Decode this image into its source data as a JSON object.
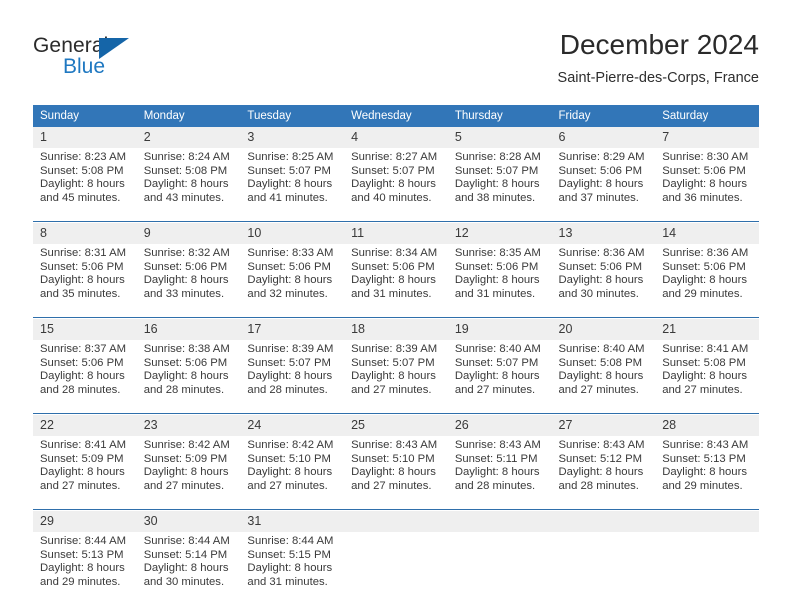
{
  "logo": {
    "text_primary": "General",
    "text_secondary": "Blue",
    "triangle_icon": "triangle-icon",
    "primary_color": "#2b2b2b",
    "secondary_color": "#1f78c1",
    "triangle_color": "#1565a8"
  },
  "header": {
    "title": "December 2024",
    "subtitle": "Saint-Pierre-des-Corps, France"
  },
  "colors": {
    "header_row_bg": "#3276b8",
    "header_row_text": "#ffffff",
    "daynum_bg": "#efefef",
    "separator": "#2f6fab",
    "body_text": "#3a3a3a"
  },
  "calendar": {
    "weekday_headers": [
      "Sunday",
      "Monday",
      "Tuesday",
      "Wednesday",
      "Thursday",
      "Friday",
      "Saturday"
    ],
    "weeks": [
      {
        "days": [
          {
            "date": "1",
            "sunrise": "Sunrise: 8:23 AM",
            "sunset": "Sunset: 5:08 PM",
            "daylight_line1": "Daylight: 8 hours",
            "daylight_line2": "and 45 minutes."
          },
          {
            "date": "2",
            "sunrise": "Sunrise: 8:24 AM",
            "sunset": "Sunset: 5:08 PM",
            "daylight_line1": "Daylight: 8 hours",
            "daylight_line2": "and 43 minutes."
          },
          {
            "date": "3",
            "sunrise": "Sunrise: 8:25 AM",
            "sunset": "Sunset: 5:07 PM",
            "daylight_line1": "Daylight: 8 hours",
            "daylight_line2": "and 41 minutes."
          },
          {
            "date": "4",
            "sunrise": "Sunrise: 8:27 AM",
            "sunset": "Sunset: 5:07 PM",
            "daylight_line1": "Daylight: 8 hours",
            "daylight_line2": "and 40 minutes."
          },
          {
            "date": "5",
            "sunrise": "Sunrise: 8:28 AM",
            "sunset": "Sunset: 5:07 PM",
            "daylight_line1": "Daylight: 8 hours",
            "daylight_line2": "and 38 minutes."
          },
          {
            "date": "6",
            "sunrise": "Sunrise: 8:29 AM",
            "sunset": "Sunset: 5:06 PM",
            "daylight_line1": "Daylight: 8 hours",
            "daylight_line2": "and 37 minutes."
          },
          {
            "date": "7",
            "sunrise": "Sunrise: 8:30 AM",
            "sunset": "Sunset: 5:06 PM",
            "daylight_line1": "Daylight: 8 hours",
            "daylight_line2": "and 36 minutes."
          }
        ]
      },
      {
        "days": [
          {
            "date": "8",
            "sunrise": "Sunrise: 8:31 AM",
            "sunset": "Sunset: 5:06 PM",
            "daylight_line1": "Daylight: 8 hours",
            "daylight_line2": "and 35 minutes."
          },
          {
            "date": "9",
            "sunrise": "Sunrise: 8:32 AM",
            "sunset": "Sunset: 5:06 PM",
            "daylight_line1": "Daylight: 8 hours",
            "daylight_line2": "and 33 minutes."
          },
          {
            "date": "10",
            "sunrise": "Sunrise: 8:33 AM",
            "sunset": "Sunset: 5:06 PM",
            "daylight_line1": "Daylight: 8 hours",
            "daylight_line2": "and 32 minutes."
          },
          {
            "date": "11",
            "sunrise": "Sunrise: 8:34 AM",
            "sunset": "Sunset: 5:06 PM",
            "daylight_line1": "Daylight: 8 hours",
            "daylight_line2": "and 31 minutes."
          },
          {
            "date": "12",
            "sunrise": "Sunrise: 8:35 AM",
            "sunset": "Sunset: 5:06 PM",
            "daylight_line1": "Daylight: 8 hours",
            "daylight_line2": "and 31 minutes."
          },
          {
            "date": "13",
            "sunrise": "Sunrise: 8:36 AM",
            "sunset": "Sunset: 5:06 PM",
            "daylight_line1": "Daylight: 8 hours",
            "daylight_line2": "and 30 minutes."
          },
          {
            "date": "14",
            "sunrise": "Sunrise: 8:36 AM",
            "sunset": "Sunset: 5:06 PM",
            "daylight_line1": "Daylight: 8 hours",
            "daylight_line2": "and 29 minutes."
          }
        ]
      },
      {
        "days": [
          {
            "date": "15",
            "sunrise": "Sunrise: 8:37 AM",
            "sunset": "Sunset: 5:06 PM",
            "daylight_line1": "Daylight: 8 hours",
            "daylight_line2": "and 28 minutes."
          },
          {
            "date": "16",
            "sunrise": "Sunrise: 8:38 AM",
            "sunset": "Sunset: 5:06 PM",
            "daylight_line1": "Daylight: 8 hours",
            "daylight_line2": "and 28 minutes."
          },
          {
            "date": "17",
            "sunrise": "Sunrise: 8:39 AM",
            "sunset": "Sunset: 5:07 PM",
            "daylight_line1": "Daylight: 8 hours",
            "daylight_line2": "and 28 minutes."
          },
          {
            "date": "18",
            "sunrise": "Sunrise: 8:39 AM",
            "sunset": "Sunset: 5:07 PM",
            "daylight_line1": "Daylight: 8 hours",
            "daylight_line2": "and 27 minutes."
          },
          {
            "date": "19",
            "sunrise": "Sunrise: 8:40 AM",
            "sunset": "Sunset: 5:07 PM",
            "daylight_line1": "Daylight: 8 hours",
            "daylight_line2": "and 27 minutes."
          },
          {
            "date": "20",
            "sunrise": "Sunrise: 8:40 AM",
            "sunset": "Sunset: 5:08 PM",
            "daylight_line1": "Daylight: 8 hours",
            "daylight_line2": "and 27 minutes."
          },
          {
            "date": "21",
            "sunrise": "Sunrise: 8:41 AM",
            "sunset": "Sunset: 5:08 PM",
            "daylight_line1": "Daylight: 8 hours",
            "daylight_line2": "and 27 minutes."
          }
        ]
      },
      {
        "days": [
          {
            "date": "22",
            "sunrise": "Sunrise: 8:41 AM",
            "sunset": "Sunset: 5:09 PM",
            "daylight_line1": "Daylight: 8 hours",
            "daylight_line2": "and 27 minutes."
          },
          {
            "date": "23",
            "sunrise": "Sunrise: 8:42 AM",
            "sunset": "Sunset: 5:09 PM",
            "daylight_line1": "Daylight: 8 hours",
            "daylight_line2": "and 27 minutes."
          },
          {
            "date": "24",
            "sunrise": "Sunrise: 8:42 AM",
            "sunset": "Sunset: 5:10 PM",
            "daylight_line1": "Daylight: 8 hours",
            "daylight_line2": "and 27 minutes."
          },
          {
            "date": "25",
            "sunrise": "Sunrise: 8:43 AM",
            "sunset": "Sunset: 5:10 PM",
            "daylight_line1": "Daylight: 8 hours",
            "daylight_line2": "and 27 minutes."
          },
          {
            "date": "26",
            "sunrise": "Sunrise: 8:43 AM",
            "sunset": "Sunset: 5:11 PM",
            "daylight_line1": "Daylight: 8 hours",
            "daylight_line2": "and 28 minutes."
          },
          {
            "date": "27",
            "sunrise": "Sunrise: 8:43 AM",
            "sunset": "Sunset: 5:12 PM",
            "daylight_line1": "Daylight: 8 hours",
            "daylight_line2": "and 28 minutes."
          },
          {
            "date": "28",
            "sunrise": "Sunrise: 8:43 AM",
            "sunset": "Sunset: 5:13 PM",
            "daylight_line1": "Daylight: 8 hours",
            "daylight_line2": "and 29 minutes."
          }
        ]
      },
      {
        "days": [
          {
            "date": "29",
            "sunrise": "Sunrise: 8:44 AM",
            "sunset": "Sunset: 5:13 PM",
            "daylight_line1": "Daylight: 8 hours",
            "daylight_line2": "and 29 minutes."
          },
          {
            "date": "30",
            "sunrise": "Sunrise: 8:44 AM",
            "sunset": "Sunset: 5:14 PM",
            "daylight_line1": "Daylight: 8 hours",
            "daylight_line2": "and 30 minutes."
          },
          {
            "date": "31",
            "sunrise": "Sunrise: 8:44 AM",
            "sunset": "Sunset: 5:15 PM",
            "daylight_line1": "Daylight: 8 hours",
            "daylight_line2": "and 31 minutes."
          },
          {
            "date": "",
            "sunrise": "",
            "sunset": "",
            "daylight_line1": "",
            "daylight_line2": ""
          },
          {
            "date": "",
            "sunrise": "",
            "sunset": "",
            "daylight_line1": "",
            "daylight_line2": ""
          },
          {
            "date": "",
            "sunrise": "",
            "sunset": "",
            "daylight_line1": "",
            "daylight_line2": ""
          },
          {
            "date": "",
            "sunrise": "",
            "sunset": "",
            "daylight_line1": "",
            "daylight_line2": ""
          }
        ]
      }
    ]
  }
}
